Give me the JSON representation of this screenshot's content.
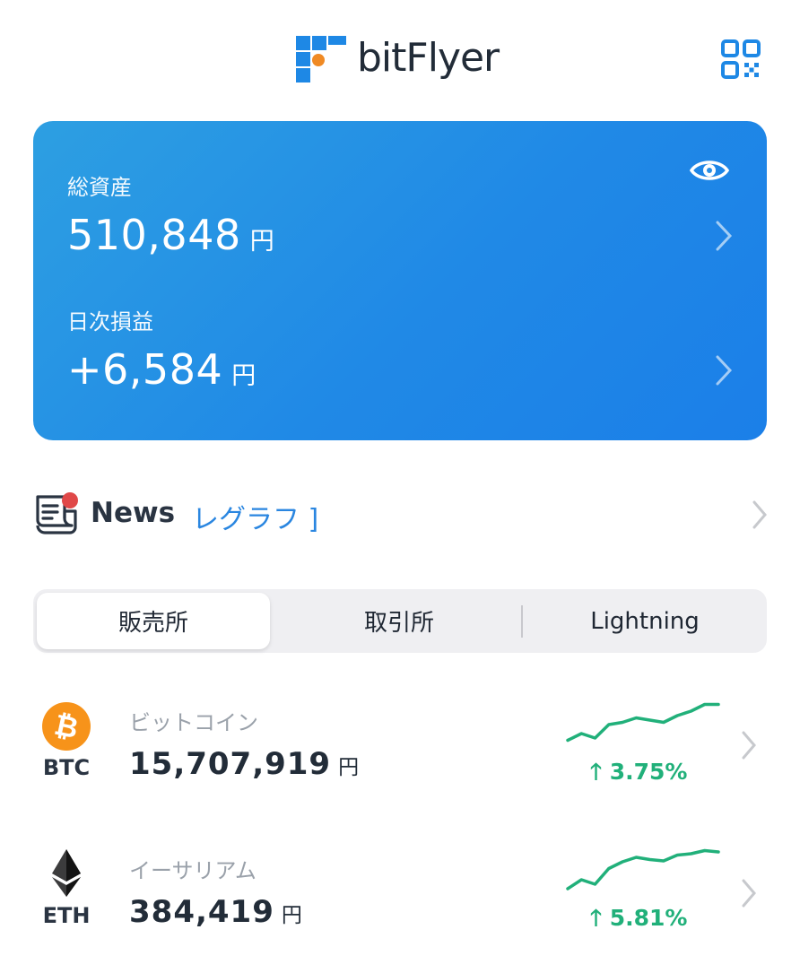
{
  "header": {
    "logo_text": "bitFlyer",
    "qr_icon": "qr-code-icon"
  },
  "balance_card": {
    "total_assets_label": "総資産",
    "total_assets_value": "510,848",
    "total_assets_unit": "円",
    "daily_pnl_label": "日次損益",
    "daily_pnl_value": "+6,584",
    "daily_pnl_unit": "円",
    "visibility_icon": "eye-icon"
  },
  "news": {
    "title": "News",
    "ticker_text": "レグラフ ]"
  },
  "tabs": [
    {
      "label": "販売所",
      "active": true
    },
    {
      "label": "取引所",
      "active": false
    },
    {
      "label": "Lightning",
      "active": false
    }
  ],
  "coins": [
    {
      "name": "ビットコイン",
      "symbol": "BTC",
      "price": "15,707,919",
      "unit": "円",
      "change": "3.75%",
      "direction": "up",
      "sparkline": [
        0.15,
        0.3,
        0.2,
        0.5,
        0.55,
        0.65,
        0.6,
        0.55,
        0.7,
        0.8,
        0.95,
        0.95
      ]
    },
    {
      "name": "イーサリアム",
      "symbol": "ETH",
      "price": "384,419",
      "unit": "円",
      "change": "5.81%",
      "direction": "up",
      "sparkline": [
        0.1,
        0.3,
        0.2,
        0.55,
        0.7,
        0.8,
        0.75,
        0.72,
        0.85,
        0.88,
        0.95,
        0.92
      ]
    }
  ],
  "colors": {
    "accent": "#2a86e0",
    "card_gradient_start": "#2d9fe2",
    "card_gradient_end": "#1b7fe8",
    "positive": "#21b07a",
    "btc_orange": "#f7931a"
  }
}
